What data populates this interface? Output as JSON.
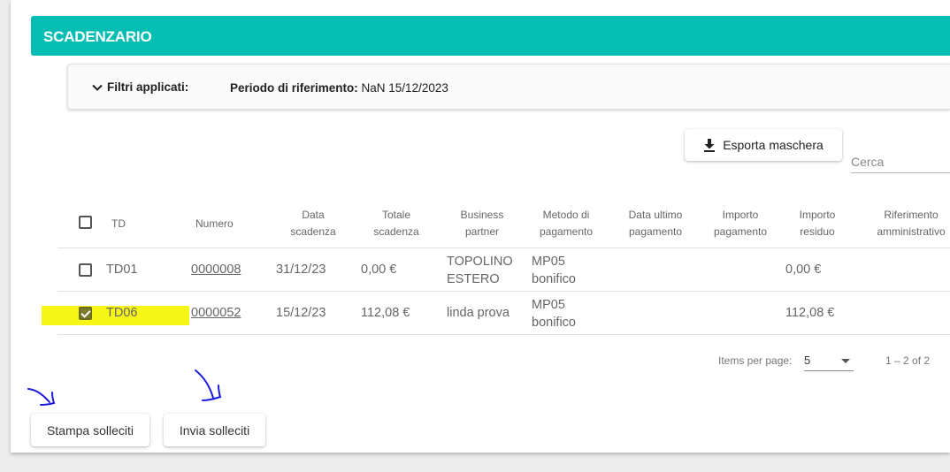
{
  "header": {
    "title": "SCADENZARIO"
  },
  "filters": {
    "toggle_label": "Filtri applicati:",
    "period_label": "Periodo di riferimento:",
    "period_value": "NaN 15/12/2023"
  },
  "toolbar": {
    "export_label": "Esporta maschera",
    "search_placeholder": "Cerca"
  },
  "table": {
    "headers": {
      "td": "TD",
      "numero": "Numero",
      "data_scadenza": [
        "Data",
        "scadenza"
      ],
      "totale_scadenza": [
        "Totale",
        "scadenza"
      ],
      "business_partner": [
        "Business",
        "partner"
      ],
      "metodo_pagamento": [
        "Metodo di",
        "pagamento"
      ],
      "data_ultimo_pagamento": [
        "Data ultimo",
        "pagamento"
      ],
      "importo_pagamento": [
        "Importo",
        "pagamento"
      ],
      "importo_residuo": [
        "Importo",
        "residuo"
      ],
      "riferimento_amministrativo": [
        "Riferimento",
        "amministrativo"
      ]
    },
    "rows": [
      {
        "checked": false,
        "td": "TD01",
        "numero": "0000008",
        "data_scadenza": "31/12/23",
        "totale": "0,00 €",
        "partner": [
          "TOPOLINO",
          "ESTERO"
        ],
        "metodo": [
          "MP05",
          "bonifico"
        ],
        "residuo": "0,00 €"
      },
      {
        "checked": true,
        "td": "TD06",
        "numero": "0000052",
        "data_scadenza": "15/12/23",
        "totale": "112,08 €",
        "partner": "linda prova",
        "metodo": [
          "MP05",
          "bonifico"
        ],
        "residuo": "112,08 €"
      }
    ]
  },
  "paginator": {
    "items_per_page_label": "Items per page:",
    "page_size": "5",
    "range_label": "1 – 2 of 2"
  },
  "actions": {
    "stampa_label": "Stampa solleciti",
    "invia_label": "Invia solleciti"
  },
  "colors": {
    "header": "#06bdb4",
    "highlight": "#f6f60a",
    "annotation": "#1a1adc"
  }
}
